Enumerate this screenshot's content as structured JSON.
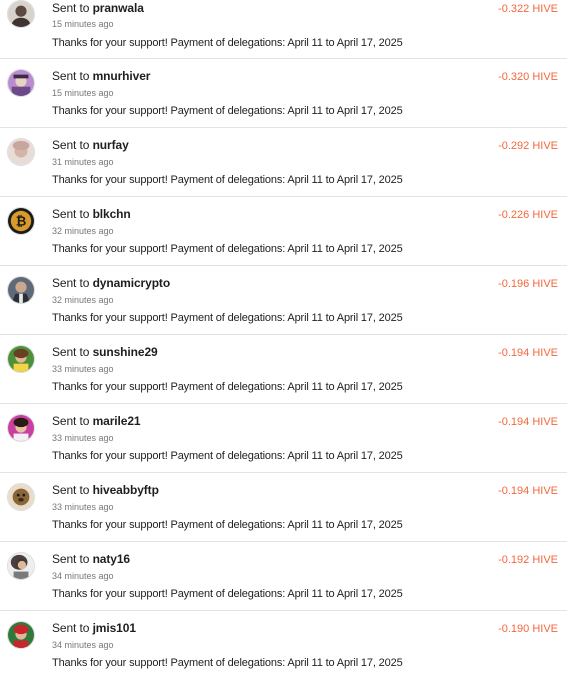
{
  "colors": {
    "amount": "#f2683c",
    "divider": "#e3e3e3",
    "muted": "#777777"
  },
  "transfers": [
    {
      "prefix": "Sent to",
      "user": "pranwala",
      "time": "15 minutes ago",
      "memo": "Thanks for your support! Payment of delegations: April 11 to April 17, 2025",
      "amount": "-0.322 HIVE",
      "avatar_icon": "user-avatar-icon"
    },
    {
      "prefix": "Sent to",
      "user": "mnurhiver",
      "time": "15 minutes ago",
      "memo": "Thanks for your support! Payment of delegations: April 11 to April 17, 2025",
      "amount": "-0.320 HIVE",
      "avatar_icon": "user-avatar-icon"
    },
    {
      "prefix": "Sent to",
      "user": "nurfay",
      "time": "31 minutes ago",
      "memo": "Thanks for your support! Payment of delegations: April 11 to April 17, 2025",
      "amount": "-0.292 HIVE",
      "avatar_icon": "user-avatar-icon"
    },
    {
      "prefix": "Sent to",
      "user": "blkchn",
      "time": "32 minutes ago",
      "memo": "Thanks for your support! Payment of delegations: April 11 to April 17, 2025",
      "amount": "-0.226 HIVE",
      "avatar_icon": "bitcoin-avatar-icon"
    },
    {
      "prefix": "Sent to",
      "user": "dynamicrypto",
      "time": "32 minutes ago",
      "memo": "Thanks for your support! Payment of delegations: April 11 to April 17, 2025",
      "amount": "-0.196 HIVE",
      "avatar_icon": "user-avatar-icon"
    },
    {
      "prefix": "Sent to",
      "user": "sunshine29",
      "time": "33 minutes ago",
      "memo": "Thanks for your support! Payment of delegations: April 11 to April 17, 2025",
      "amount": "-0.194 HIVE",
      "avatar_icon": "user-avatar-icon"
    },
    {
      "prefix": "Sent to",
      "user": "marile21",
      "time": "33 minutes ago",
      "memo": "Thanks for your support! Payment of delegations: April 11 to April 17, 2025",
      "amount": "-0.194 HIVE",
      "avatar_icon": "user-avatar-icon"
    },
    {
      "prefix": "Sent to",
      "user": "hiveabbyftp",
      "time": "33 minutes ago",
      "memo": "Thanks for your support! Payment of delegations: April 11 to April 17, 2025",
      "amount": "-0.194 HIVE",
      "avatar_icon": "user-avatar-icon"
    },
    {
      "prefix": "Sent to",
      "user": "naty16",
      "time": "34 minutes ago",
      "memo": "Thanks for your support! Payment of delegations: April 11 to April 17, 2025",
      "amount": "-0.192 HIVE",
      "avatar_icon": "user-avatar-icon"
    },
    {
      "prefix": "Sent to",
      "user": "jmis101",
      "time": "34 minutes ago",
      "memo": "Thanks for your support! Payment of delegations: April 11 to April 17, 2025",
      "amount": "-0.190 HIVE",
      "avatar_icon": "user-avatar-icon"
    }
  ]
}
